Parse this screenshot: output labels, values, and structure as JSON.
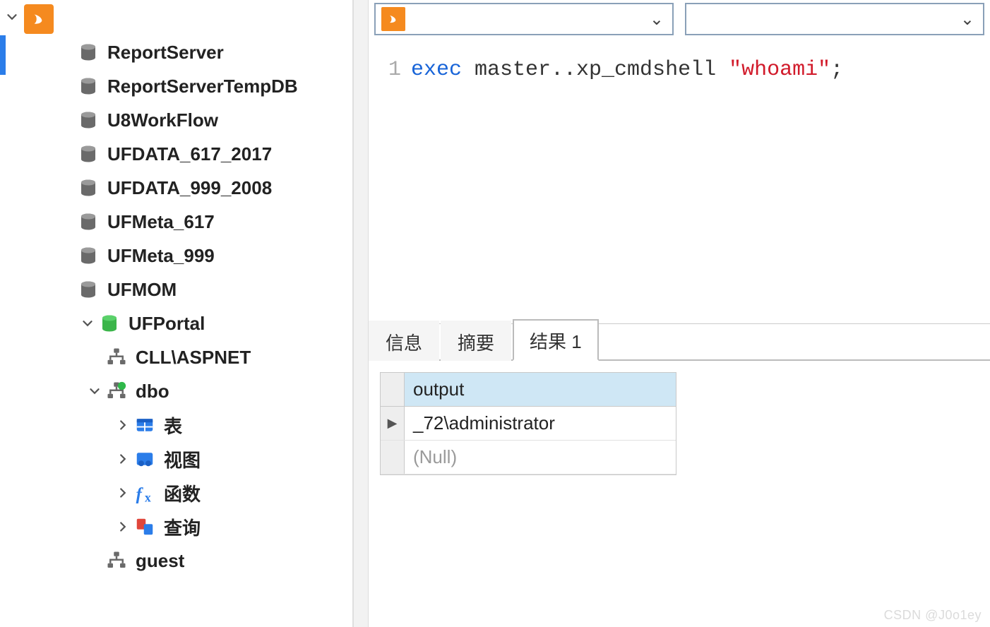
{
  "sidebar": {
    "connection_label": "",
    "databases": [
      {
        "name": "ReportServer"
      },
      {
        "name": "ReportServerTempDB"
      },
      {
        "name": "U8WorkFlow"
      },
      {
        "name": "UFDATA_617_2017"
      },
      {
        "name": "UFDATA_999_2008"
      },
      {
        "name": "UFMeta_617"
      },
      {
        "name": "UFMeta_999"
      },
      {
        "name": "UFMOM"
      }
    ],
    "expanded_db": {
      "name": "UFPortal",
      "schemas": [
        {
          "name": "CLL\\ASPNET",
          "expanded": false,
          "icon": "schema"
        },
        {
          "name": "dbo",
          "expanded": true,
          "icon": "schema-green",
          "children": [
            {
              "label": "表",
              "icon": "table"
            },
            {
              "label": "视图",
              "icon": "view"
            },
            {
              "label": "函数",
              "icon": "fx"
            },
            {
              "label": "查询",
              "icon": "query"
            }
          ]
        },
        {
          "name": "guest",
          "expanded": false,
          "icon": "schema"
        }
      ]
    }
  },
  "toolbar": {
    "combo1": {
      "text": ""
    },
    "combo2": {
      "text": ""
    }
  },
  "editor": {
    "line_number": "1",
    "tokens": {
      "kw": "exec",
      "mid": " master..xp_cmdshell ",
      "str": "\"whoami\"",
      "tail": ";"
    }
  },
  "result_tabs": [
    "信息",
    "摘要",
    "结果 1"
  ],
  "active_tab": 2,
  "grid": {
    "column": "output",
    "rows": [
      {
        "value": "     _72\\administrator",
        "current": true
      },
      {
        "value": "(Null)",
        "null": true
      }
    ]
  },
  "watermark": "CSDN @J0o1ey"
}
